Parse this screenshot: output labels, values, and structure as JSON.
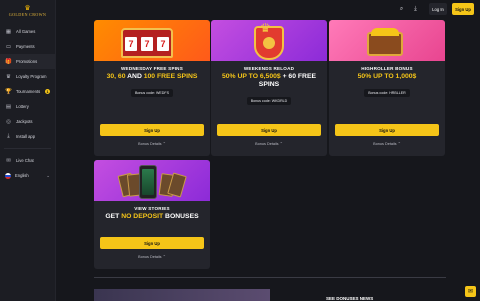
{
  "logo": {
    "text": "GOLDEN CROWN"
  },
  "sidebar": {
    "items": [
      {
        "label": "All Games",
        "icon": "grid-icon"
      },
      {
        "label": "Payments",
        "icon": "card-icon"
      },
      {
        "label": "Promotions",
        "icon": "gift-icon",
        "active": true
      },
      {
        "label": "Loyalty Program",
        "icon": "crown-icon"
      },
      {
        "label": "Tournaments",
        "icon": "trophy-icon",
        "badge": "1"
      },
      {
        "label": "Lottery",
        "icon": "ticket-icon"
      },
      {
        "label": "Jackpots",
        "icon": "coins-icon"
      },
      {
        "label": "Install app",
        "icon": "download-icon"
      }
    ],
    "live_chat": "Live Chat",
    "language": "English"
  },
  "topbar": {
    "login": "Log In",
    "signup": "Sign Up"
  },
  "cards": [
    {
      "title": "WEDNESDAY FREE SPINS",
      "headline_parts": [
        "30, 60",
        " AND ",
        "100",
        " FREE SPINS"
      ],
      "code": "Bonus code: WEDFS",
      "cta": "Sign Up",
      "details": "Bonus Details ⌃"
    },
    {
      "title": "WEEKENDS RELOAD",
      "headline_parts": [
        "50% UP TO 6,500$",
        " + 60 FREE SPINS"
      ],
      "code": "Bonus code: WKDRLD",
      "cta": "Sign Up",
      "details": "Bonus Details ⌃"
    },
    {
      "title": "HIGHROLLER BONUS",
      "headline_parts": [
        "50% UP TO 1,000$"
      ],
      "code": "Bonus code: HRBLLER",
      "cta": "Sign Up",
      "details": "Bonus Details ⌃"
    },
    {
      "title": "VIEW STORIES",
      "headline_parts": [
        "GET ",
        "NO DEPOSIT",
        " BONUSES"
      ],
      "cta": "Sign Up",
      "details": "Bonus Details ⌃"
    }
  ],
  "bottom": {
    "heading": "SEE DONUSES NEWS"
  },
  "colors": {
    "accent": "#f5c518",
    "bg": "#16171c",
    "card": "#24252c"
  }
}
